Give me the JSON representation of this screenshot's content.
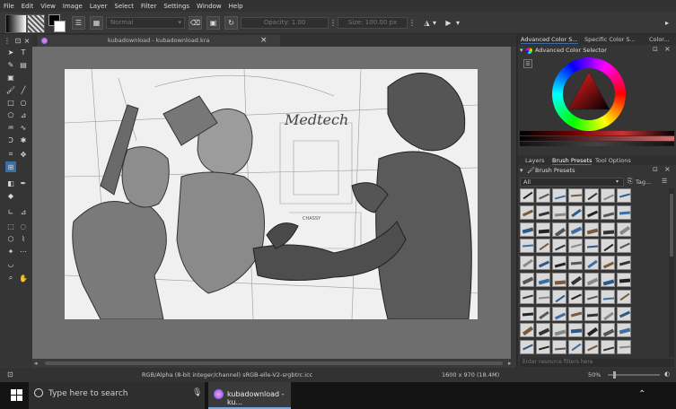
{
  "menu": [
    "File",
    "Edit",
    "View",
    "Image",
    "Layer",
    "Select",
    "Filter",
    "Settings",
    "Window",
    "Help"
  ],
  "toolbar": {
    "blend_mode": "Normal",
    "opacity": "Opacity: 1.00",
    "size": "Size: 100.00 px"
  },
  "document": {
    "tab_title": "kubadownload - kubadownload.kra"
  },
  "canvas": {
    "sign_text": "Medtech",
    "label_text": "CHASSY"
  },
  "dock": {
    "top_tabs": [
      "Advanced Color S...",
      "Specific Color S...",
      "Color..."
    ],
    "color_panel_title": "Advanced Color Selector",
    "mid_tabs": [
      "Layers",
      "Brush Presets",
      "Tool Options"
    ],
    "brush_panel_title": "Brush Presets",
    "filter_value": "All",
    "tag_label": "Tag...",
    "resource_filter_placeholder": "Enter resource filters here"
  },
  "status": {
    "color_info": "RGB/Alpha (8-bit integer/channel)  sRGB-elle-V2-srgbtrc.icc",
    "dimensions": "1600 x 970 (18.4M)",
    "zoom": "50%"
  },
  "taskbar": {
    "search_placeholder": "Type here to search",
    "app_label": "kubadownload - ku..."
  },
  "colors": {
    "accent": "#3a6ea5",
    "canvas_bg": "#6e6e6e"
  }
}
